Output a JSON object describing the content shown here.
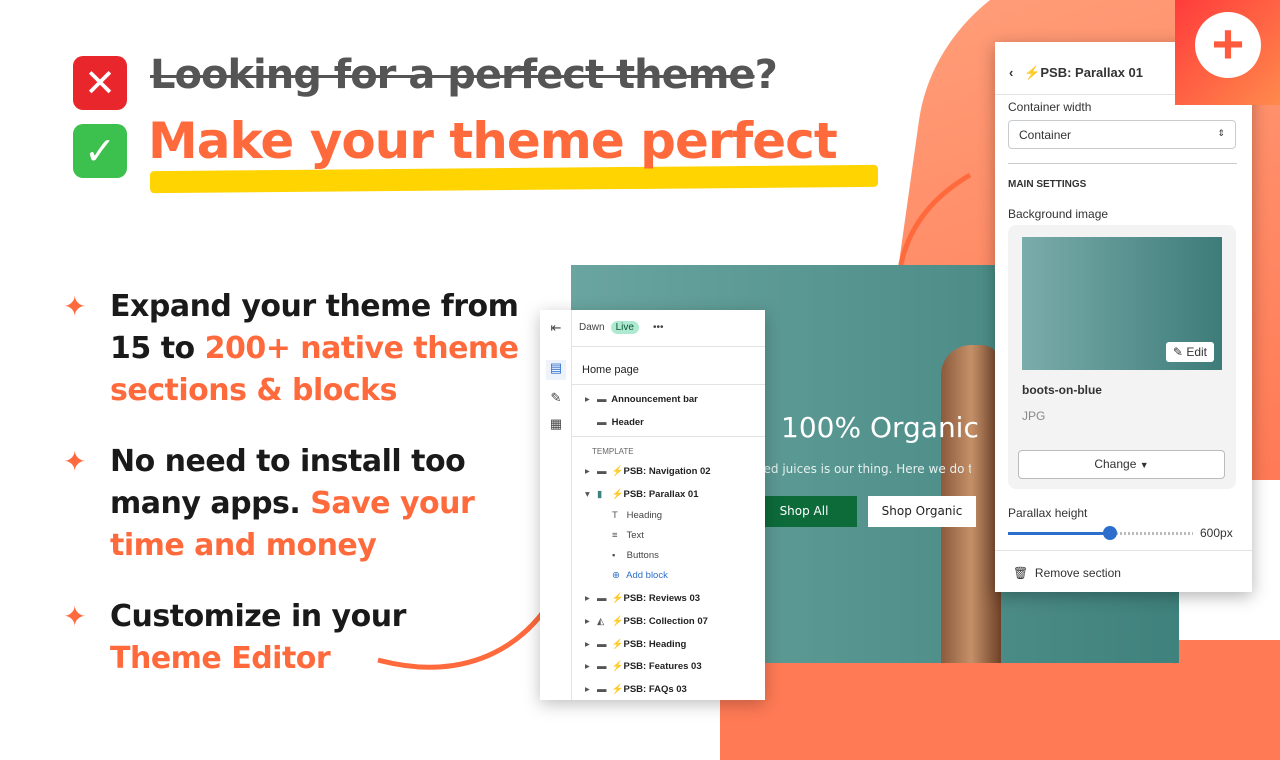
{
  "headline": {
    "crossed": "Looking for a perfect theme",
    "question_mark": "?",
    "main": "Make your theme perfect",
    "x_icon": "cross-mark-icon",
    "check_icon": "check-mark-icon"
  },
  "bullets": [
    {
      "a": "Expand your theme from",
      "b": "15 to ",
      "c": "200+ native theme sections & blocks"
    },
    {
      "a": "No need to install too many apps. ",
      "c": "Save your time and money"
    },
    {
      "a": "Customize in your ",
      "c": "Theme Editor"
    }
  ],
  "colors": {
    "accent": "#ff6a3d",
    "highlight": "#ffd400",
    "shopify_blue": "#2c6ecb",
    "shop_green": "#0d6b3a"
  },
  "preview": {
    "heading": "100% Organic",
    "paragraph": "ssed juices is our thing. Here we do things differently",
    "btn_all": "Shop All",
    "btn_organic": "Shop Organic"
  },
  "editor": {
    "theme": "Dawn",
    "live": "Live",
    "more": "•••",
    "page": "Home page",
    "announcement": "Announcement bar",
    "header": "Header",
    "template": "TEMPLATE",
    "sections": [
      "PSB: Navigation 02",
      "PSB: Parallax 01"
    ],
    "blocks": [
      "Heading",
      "Text",
      "Buttons"
    ],
    "add_block": "Add block",
    "more_sections": [
      "PSB: Reviews 03",
      "PSB: Collection 07",
      "PSB: Heading",
      "PSB: Features 03",
      "PSB: FAQs 03"
    ]
  },
  "settings": {
    "title": "PSB: Parallax 01",
    "container_label": "Container width",
    "container_value": "Container",
    "main": "MAIN SETTINGS",
    "bg_label": "Background image",
    "edit": "Edit",
    "file": "boots-on-blue",
    "type": "JPG",
    "change": "Change",
    "parallax_label": "Parallax height",
    "parallax_value": "600px",
    "parallax_fraction": 0.55,
    "remove": "Remove section"
  }
}
